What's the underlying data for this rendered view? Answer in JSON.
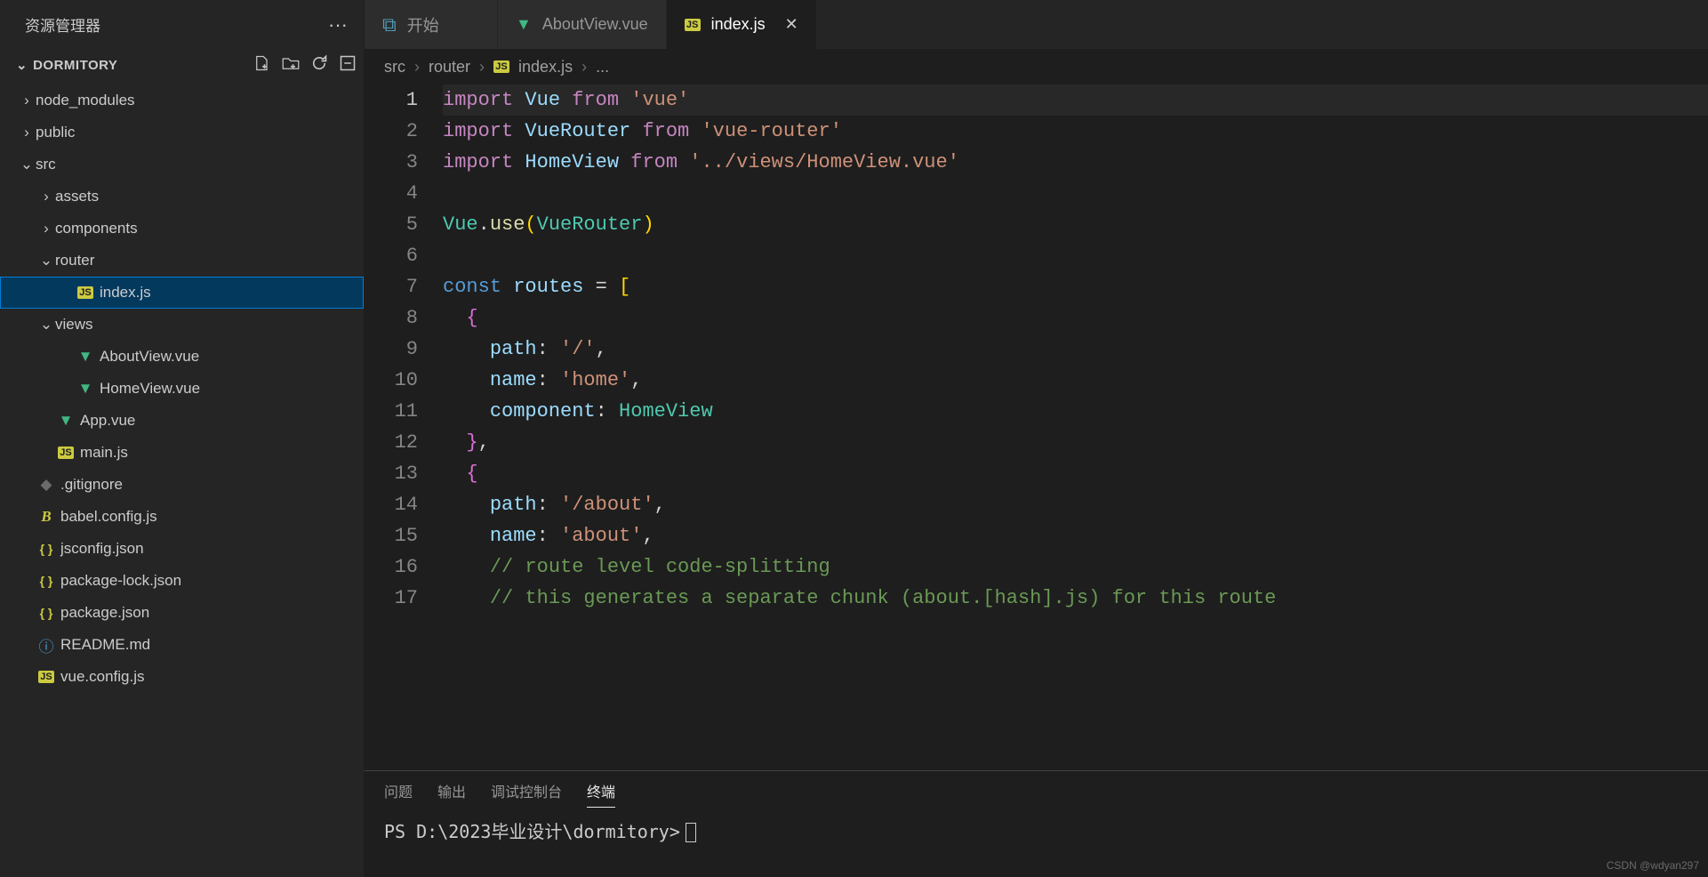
{
  "sidebar": {
    "title": "资源管理器",
    "project": "DORMITORY",
    "tree": [
      {
        "type": "folder",
        "label": "node_modules",
        "depth": 0,
        "open": false
      },
      {
        "type": "folder",
        "label": "public",
        "depth": 0,
        "open": false
      },
      {
        "type": "folder",
        "label": "src",
        "depth": 0,
        "open": true
      },
      {
        "type": "folder",
        "label": "assets",
        "depth": 1,
        "open": false
      },
      {
        "type": "folder",
        "label": "components",
        "depth": 1,
        "open": false
      },
      {
        "type": "folder",
        "label": "router",
        "depth": 1,
        "open": true
      },
      {
        "type": "file",
        "label": "index.js",
        "depth": 2,
        "icon": "js",
        "selected": true
      },
      {
        "type": "folder",
        "label": "views",
        "depth": 1,
        "open": true
      },
      {
        "type": "file",
        "label": "AboutView.vue",
        "depth": 2,
        "icon": "vue"
      },
      {
        "type": "file",
        "label": "HomeView.vue",
        "depth": 2,
        "icon": "vue"
      },
      {
        "type": "file",
        "label": "App.vue",
        "depth": 1,
        "icon": "vue"
      },
      {
        "type": "file",
        "label": "main.js",
        "depth": 1,
        "icon": "js"
      },
      {
        "type": "file",
        "label": ".gitignore",
        "depth": 0,
        "icon": "git"
      },
      {
        "type": "file",
        "label": "babel.config.js",
        "depth": 0,
        "icon": "babel"
      },
      {
        "type": "file",
        "label": "jsconfig.json",
        "depth": 0,
        "icon": "json"
      },
      {
        "type": "file",
        "label": "package-lock.json",
        "depth": 0,
        "icon": "json"
      },
      {
        "type": "file",
        "label": "package.json",
        "depth": 0,
        "icon": "json"
      },
      {
        "type": "file",
        "label": "README.md",
        "depth": 0,
        "icon": "readme"
      },
      {
        "type": "file",
        "label": "vue.config.js",
        "depth": 0,
        "icon": "js"
      }
    ]
  },
  "tabs": [
    {
      "label": "开始",
      "icon": "vs",
      "active": false
    },
    {
      "label": "AboutView.vue",
      "icon": "vue",
      "active": false
    },
    {
      "label": "index.js",
      "icon": "js",
      "active": true,
      "closable": true
    }
  ],
  "breadcrumb": {
    "seg1": "src",
    "seg2": "router",
    "seg3": "index.js",
    "seg4": "..."
  },
  "code": {
    "lines": [
      {
        "n": 1,
        "active": true,
        "html": "<span class='tok-kw'>import</span> <span class='tok-var'>Vue</span> <span class='tok-kw'>from</span> <span class='tok-str'>'vue'</span>"
      },
      {
        "n": 2,
        "html": "<span class='tok-kw'>import</span> <span class='tok-var'>VueRouter</span> <span class='tok-kw'>from</span> <span class='tok-str'>'vue-router'</span>"
      },
      {
        "n": 3,
        "html": "<span class='tok-kw'>import</span> <span class='tok-var'>HomeView</span> <span class='tok-kw'>from</span> <span class='tok-str'>'../views/HomeView.vue'</span>"
      },
      {
        "n": 4,
        "html": ""
      },
      {
        "n": 5,
        "html": "<span class='tok-type'>Vue</span>.<span class='tok-fn'>use</span><span class='tok-brace'>(</span><span class='tok-type'>VueRouter</span><span class='tok-brace'>)</span>"
      },
      {
        "n": 6,
        "html": ""
      },
      {
        "n": 7,
        "html": "<span class='tok-const'>const</span> <span class='tok-var'>routes</span> <span class='tok-punc'>=</span> <span class='tok-brace'>[</span>"
      },
      {
        "n": 8,
        "html": "<span class='guide'>  </span><span class='tok-brace2'>{</span>"
      },
      {
        "n": 9,
        "html": "<span class='guide'>  </span><span class='guide'>  </span><span class='tok-prop'>path</span>: <span class='tok-str'>'/'</span>,"
      },
      {
        "n": 10,
        "html": "<span class='guide'>  </span><span class='guide'>  </span><span class='tok-prop'>name</span>: <span class='tok-str'>'home'</span>,"
      },
      {
        "n": 11,
        "html": "<span class='guide'>  </span><span class='guide'>  </span><span class='tok-prop'>component</span>: <span class='tok-type'>HomeView</span>"
      },
      {
        "n": 12,
        "html": "<span class='guide'>  </span><span class='tok-brace2'>}</span>,"
      },
      {
        "n": 13,
        "html": "<span class='guide'>  </span><span class='tok-brace2'>{</span>"
      },
      {
        "n": 14,
        "html": "<span class='guide'>  </span><span class='guide'>  </span><span class='tok-prop'>path</span>: <span class='tok-str'>'/about'</span>,"
      },
      {
        "n": 15,
        "html": "<span class='guide'>  </span><span class='guide'>  </span><span class='tok-prop'>name</span>: <span class='tok-str'>'about'</span>,"
      },
      {
        "n": 16,
        "html": "<span class='guide'>  </span><span class='guide'>  </span><span class='tok-comment'>// route level code-splitting</span>"
      },
      {
        "n": 17,
        "html": "<span class='guide'>  </span><span class='guide'>  </span><span class='tok-comment'>// this generates a separate chunk (about.[hash].js) for this route</span>"
      }
    ]
  },
  "panel": {
    "tabs": [
      {
        "label": "问题",
        "active": false
      },
      {
        "label": "输出",
        "active": false
      },
      {
        "label": "调试控制台",
        "active": false
      },
      {
        "label": "终端",
        "active": true
      }
    ],
    "terminal_prompt": "PS D:\\2023毕业设计\\dormitory>"
  },
  "watermark": "CSDN @wdyan297"
}
